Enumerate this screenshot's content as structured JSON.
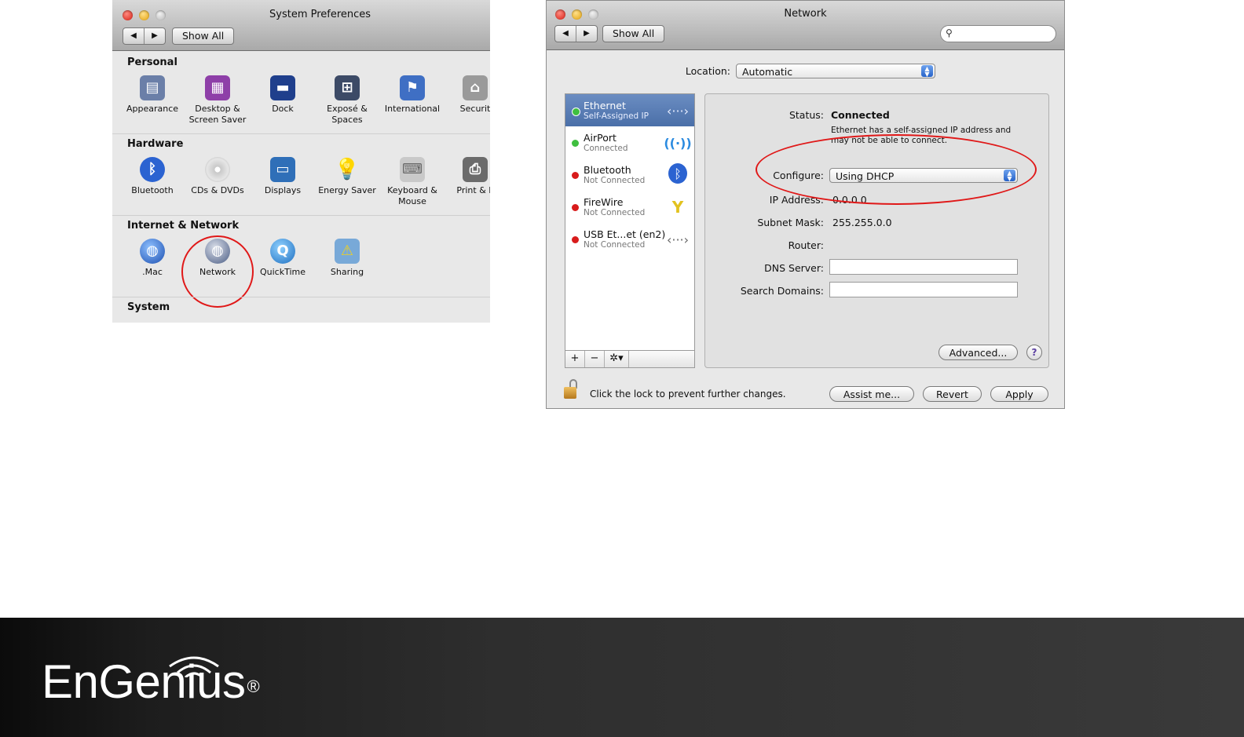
{
  "sysprefs": {
    "title": "System Preferences",
    "show_all": "Show All",
    "nav_back": "◀",
    "nav_fwd": "▶",
    "sections": [
      {
        "title": "Personal",
        "items": [
          {
            "label": "Appearance",
            "icon": "appearance-icon",
            "color": "#6b7fa8"
          },
          {
            "label": "Desktop & Screen Saver",
            "icon": "desktop-icon",
            "color": "#8e3fa8"
          },
          {
            "label": "Dock",
            "icon": "dock-icon",
            "color": "#1f3f8c"
          },
          {
            "label": "Exposé & Spaces",
            "icon": "expose-icon",
            "color": "#3c4a66"
          },
          {
            "label": "International",
            "icon": "international-icon",
            "color": "#3f6fc4"
          },
          {
            "label": "Securit",
            "icon": "security-icon",
            "color": "#9a9a9a"
          }
        ]
      },
      {
        "title": "Hardware",
        "items": [
          {
            "label": "Bluetooth",
            "icon": "bluetooth-icon",
            "color": "#2b63d1"
          },
          {
            "label": "CDs & DVDs",
            "icon": "cd-icon",
            "color": "#b8b8b8"
          },
          {
            "label": "Displays",
            "icon": "displays-icon",
            "color": "#2f6fb8"
          },
          {
            "label": "Energy Saver",
            "icon": "lightbulb-icon",
            "color": "#f2d45a"
          },
          {
            "label": "Keyboard & Mouse",
            "icon": "keyboard-icon",
            "color": "#c9c9c9"
          },
          {
            "label": "Print & F",
            "icon": "printer-icon",
            "color": "#6b6b6b"
          }
        ]
      },
      {
        "title": "Internet & Network",
        "items": [
          {
            "label": ".Mac",
            "icon": "mac-globe-icon",
            "color": "#2b66c8"
          },
          {
            "label": "Network",
            "icon": "network-globe-icon",
            "color": "#5a6e94"
          },
          {
            "label": "QuickTime",
            "icon": "quicktime-icon",
            "color": "#2c86d6"
          },
          {
            "label": "Sharing",
            "icon": "sharing-folder-icon",
            "color": "#78a9d8"
          }
        ]
      },
      {
        "title": "System",
        "items": []
      }
    ]
  },
  "network": {
    "title": "Network",
    "show_all": "Show All",
    "nav_back": "◀",
    "nav_fwd": "▶",
    "search_placeholder": "",
    "location_label": "Location:",
    "location_value": "Automatic",
    "services": [
      {
        "name": "Ethernet",
        "status": "Self-Assigned IP",
        "dot_color": "#3fbf3f",
        "icon": "ethernet-icon",
        "glyph": "‹···›",
        "selected": true
      },
      {
        "name": "AirPort",
        "status": "Connected",
        "dot_color": "#3fbf3f",
        "icon": "airport-wifi-icon",
        "glyph": "((·))",
        "selected": false
      },
      {
        "name": "Bluetooth",
        "status": "Not Connected",
        "dot_color": "#d81b1b",
        "icon": "bluetooth-icon",
        "glyph": "ᛒ",
        "selected": false
      },
      {
        "name": "FireWire",
        "status": "Not Connected",
        "dot_color": "#d81b1b",
        "icon": "firewire-icon",
        "glyph": "Y",
        "selected": false
      },
      {
        "name": "USB Et...et (en2)",
        "status": "Not Connected",
        "dot_color": "#d81b1b",
        "icon": "usb-ethernet-icon",
        "glyph": "‹···›",
        "selected": false
      }
    ],
    "list_buttons": {
      "add": "+",
      "remove": "−",
      "action": "✲▾"
    },
    "status_label": "Status:",
    "status_value": "Connected",
    "status_note": "Ethernet has a self-assigned IP address and may not be able to connect.",
    "configure_label": "Configure:",
    "configure_value": "Using DHCP",
    "ip_label": "IP Address:",
    "ip_value": "0.0.0.0",
    "subnet_label": "Subnet Mask:",
    "subnet_value": "255.255.0.0",
    "router_label": "Router:",
    "router_value": "",
    "dns_label": "DNS Server:",
    "dns_value": "",
    "search_domains_label": "Search Domains:",
    "search_domains_value": "",
    "advanced_button": "Advanced...",
    "help_button": "?",
    "lock_text": "Click the lock to prevent further changes.",
    "assist_button": "Assist me...",
    "revert_button": "Revert",
    "apply_button": "Apply"
  },
  "footer": {
    "brand": "EnGenius",
    "registered": "®"
  }
}
